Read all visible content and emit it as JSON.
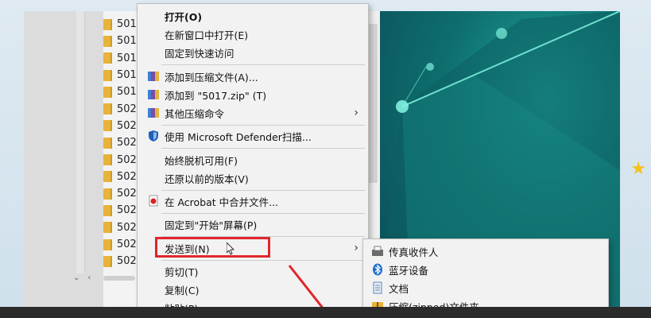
{
  "explorer": {
    "files": [
      "501",
      "501",
      "501",
      "501",
      "501",
      "502",
      "502",
      "502",
      "502",
      "502",
      "502",
      "502",
      "502",
      "502",
      "502"
    ]
  },
  "context_menu": {
    "items": [
      {
        "label": "打开(O)",
        "bold": true,
        "icon": "none"
      },
      {
        "label": "在新窗口中打开(E)",
        "icon": "none"
      },
      {
        "label": "固定到快速访问",
        "icon": "none"
      },
      {
        "label": "添加到压缩文件(A)...",
        "icon": "archive-icon"
      },
      {
        "label": "添加到 \"5017.zip\" (T)",
        "icon": "archive-icon"
      },
      {
        "label": "其他压缩命令",
        "icon": "archive-icon",
        "submenu": true
      },
      {
        "label": "使用 Microsoft Defender扫描...",
        "icon": "defender-shield-icon"
      },
      {
        "label": "始终脱机可用(F)",
        "icon": "none"
      },
      {
        "label": "还原以前的版本(V)",
        "icon": "none"
      },
      {
        "label": "在 Acrobat 中合并文件...",
        "icon": "acrobat-icon"
      },
      {
        "label": "固定到\"开始\"屏幕(P)",
        "icon": "none"
      },
      {
        "label": "发送到(N)",
        "icon": "none",
        "submenu": true,
        "highlighted": true
      },
      {
        "label": "剪切(T)",
        "icon": "none"
      },
      {
        "label": "复制(C)",
        "icon": "none"
      },
      {
        "label": "粘贴(P)",
        "icon": "none"
      }
    ]
  },
  "send_to_menu": {
    "items": [
      {
        "label": "传真收件人",
        "icon": "fax-icon"
      },
      {
        "label": "蓝牙设备",
        "icon": "bluetooth-icon"
      },
      {
        "label": "文档",
        "icon": "document-icon"
      },
      {
        "label": "压缩(zipped)文件夹",
        "icon": "zip-folder-icon"
      }
    ]
  },
  "colors": {
    "highlight": "#e0262b",
    "desktop": "#0e6e6d",
    "folder": "#e8b33a"
  }
}
